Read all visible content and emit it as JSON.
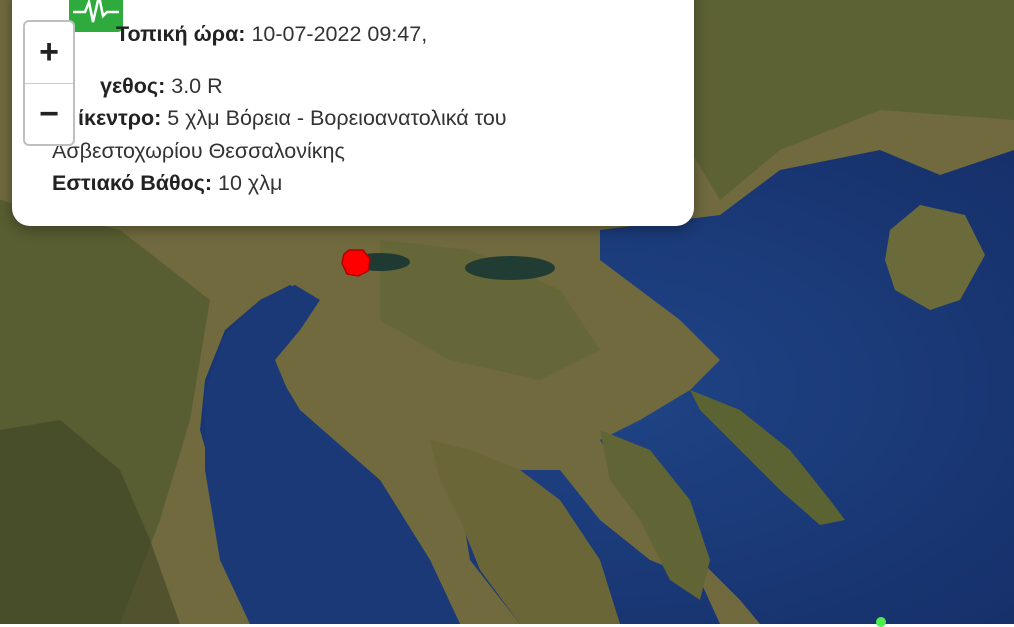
{
  "popup": {
    "time_label": "Τοπική ώρα:",
    "time_value": "10-07-2022 09:47,",
    "magnitude_label": "γεθος:",
    "magnitude_value": "3.0 R",
    "epicenter_label": "ίκεντρο:",
    "epicenter_value": "5 χλμ Βόρεια - Βορειοανατολικά του",
    "epicenter_value_cont": "Ασβεστοχωρίου Θεσσαλονίκης",
    "depth_label": "Εστιακό Βάθος:",
    "depth_value": "10 χλμ",
    "close_symbol": "×"
  },
  "zoom": {
    "in_label": "+",
    "out_label": "−"
  },
  "icons": {
    "quake": "seismograph-icon",
    "marker": "earthquake-marker-icon",
    "other": "other-event-marker"
  },
  "colors": {
    "marker": "#ff0000",
    "quake_icon_bg": "#2faa3c",
    "other_event": "#4cf04c",
    "sea": "#1a3a7a",
    "land": "#6f6a3c"
  }
}
